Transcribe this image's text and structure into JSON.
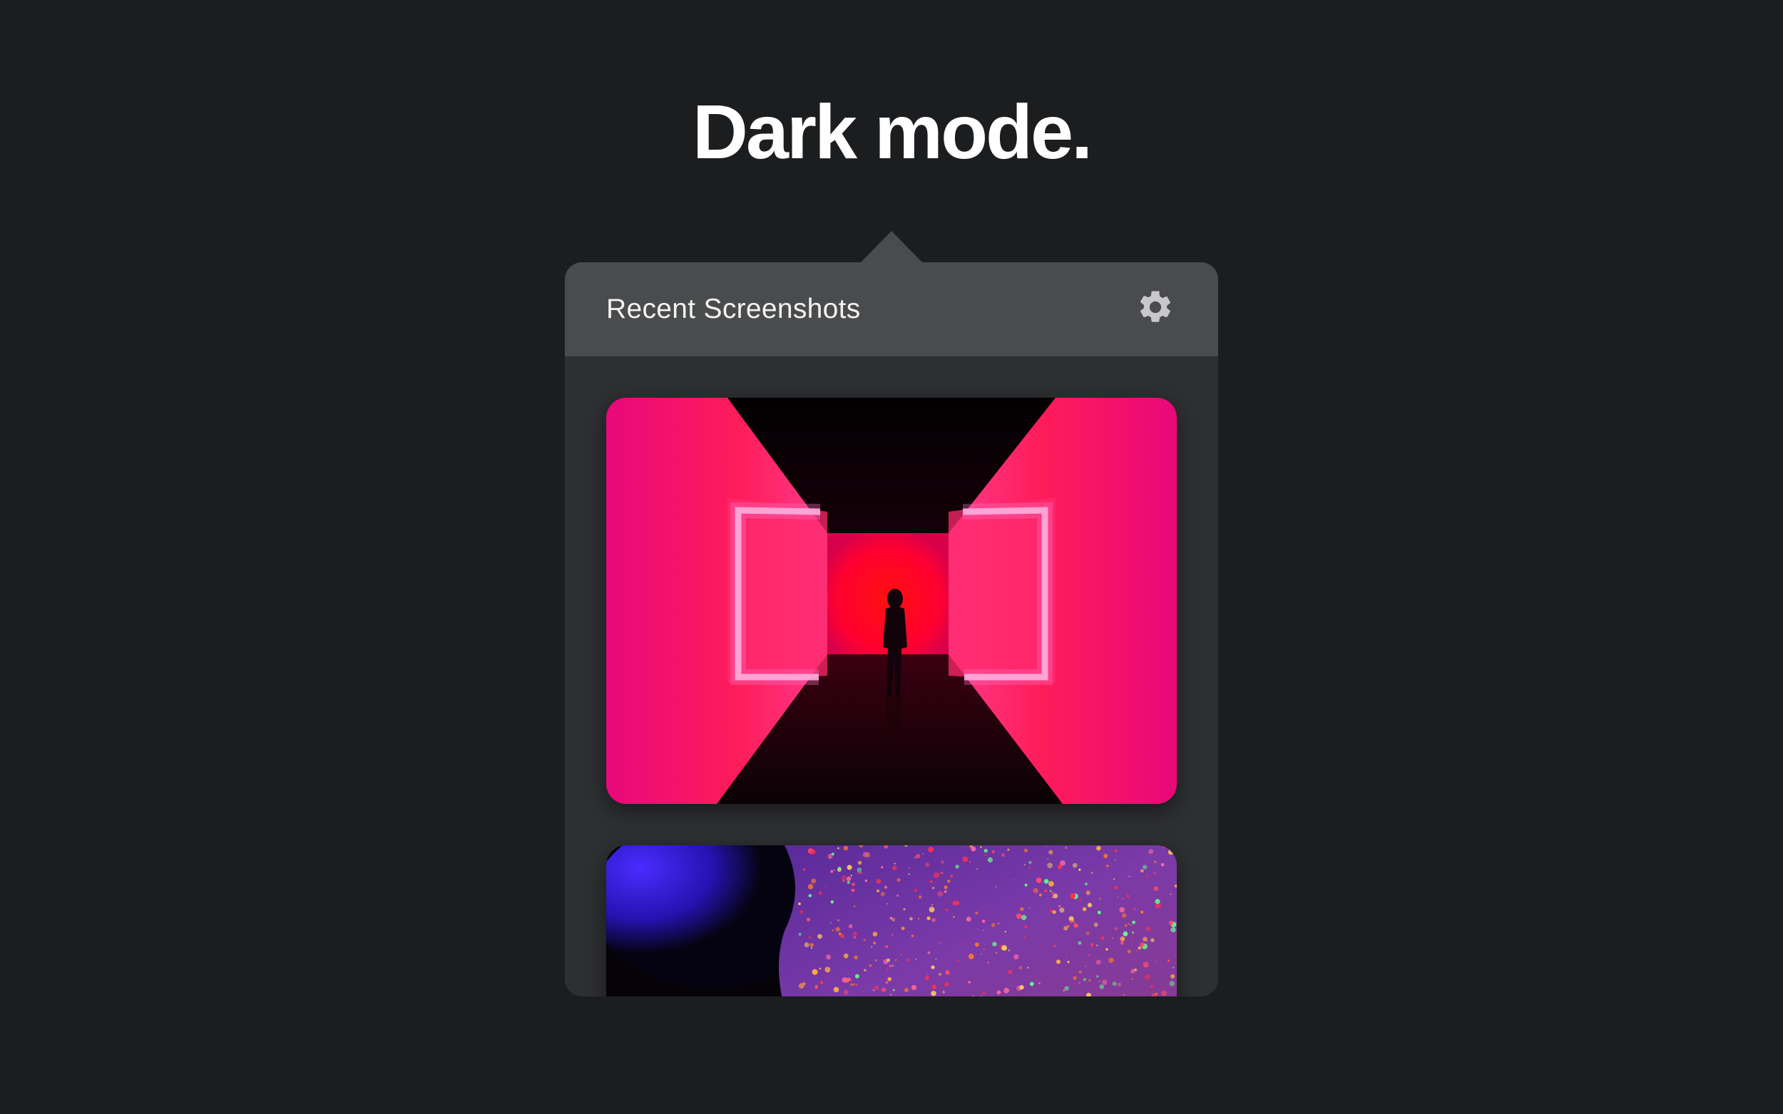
{
  "headline": "Dark mode.",
  "popover": {
    "title": "Recent Screenshots",
    "settings_icon": "gear-icon",
    "screenshots": [
      {
        "kind": "photo",
        "subject": "neon-pink-corridor"
      },
      {
        "kind": "photo",
        "subject": "glitter-colorful-texture"
      }
    ]
  },
  "colors": {
    "background": "#1c1d1f",
    "popover_body": "#2e2f31",
    "popover_header": "#4a4b4c",
    "text": "#ffffff",
    "gear": "#c8c8cc"
  }
}
